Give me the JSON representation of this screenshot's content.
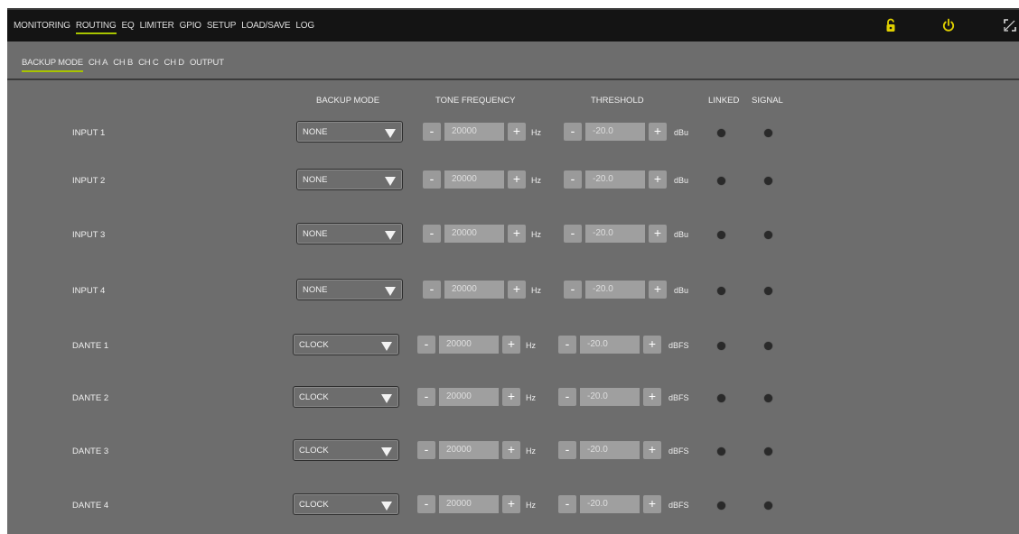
{
  "top_nav": [
    {
      "label": "MONITORING",
      "active": false
    },
    {
      "label": "ROUTING",
      "active": true
    },
    {
      "label": "EQ",
      "active": false
    },
    {
      "label": "LIMITER",
      "active": false
    },
    {
      "label": "GPIO",
      "active": false
    },
    {
      "label": "SETUP",
      "active": false
    },
    {
      "label": "LOAD/SAVE",
      "active": false
    },
    {
      "label": "LOG",
      "active": false
    }
  ],
  "top_icons": {
    "lock": "lock-icon",
    "power": "power-icon",
    "fullscreen": "fullscreen-icon"
  },
  "sub_nav": [
    {
      "label": "BACKUP MODE",
      "active": true
    },
    {
      "label": "CH A",
      "active": false
    },
    {
      "label": "CH B",
      "active": false
    },
    {
      "label": "CH C",
      "active": false
    },
    {
      "label": "CH D",
      "active": false
    },
    {
      "label": "OUTPUT",
      "active": false
    }
  ],
  "headers": {
    "backup_mode": "BACKUP MODE",
    "tone_frequency": "TONE FREQUENCY",
    "threshold": "THRESHOLD",
    "linked": "LINKED",
    "signal": "SIGNAL"
  },
  "rows": [
    {
      "label": "INPUT 1",
      "mode": "NONE",
      "minus": "-",
      "freq": "20000",
      "plus": "+",
      "freq_unit": "Hz",
      "thr": "-20.0",
      "thr_unit": "dBu"
    },
    {
      "label": "INPUT 2",
      "mode": "NONE",
      "minus": "-",
      "freq": "20000",
      "plus": "+",
      "freq_unit": "Hz",
      "thr": "-20.0",
      "thr_unit": "dBu"
    },
    {
      "label": "INPUT 3",
      "mode": "NONE",
      "minus": "-",
      "freq": "20000",
      "plus": "+",
      "freq_unit": "Hz",
      "thr": "-20.0",
      "thr_unit": "dBu"
    },
    {
      "label": "INPUT 4",
      "mode": "NONE",
      "minus": "-",
      "freq": "20000",
      "plus": "+",
      "freq_unit": "Hz",
      "thr": "-20.0",
      "thr_unit": "dBu"
    },
    {
      "label": "DANTE 1",
      "mode": "CLOCK",
      "minus": "-",
      "freq": "20000",
      "plus": "+",
      "freq_unit": "Hz",
      "thr": "-20.0",
      "thr_unit": "dBFS"
    },
    {
      "label": "DANTE 2",
      "mode": "CLOCK",
      "minus": "-",
      "freq": "20000",
      "plus": "+",
      "freq_unit": "Hz",
      "thr": "-20.0",
      "thr_unit": "dBFS"
    },
    {
      "label": "DANTE 3",
      "mode": "CLOCK",
      "minus": "-",
      "freq": "20000",
      "plus": "+",
      "freq_unit": "Hz",
      "thr": "-20.0",
      "thr_unit": "dBFS"
    },
    {
      "label": "DANTE 4",
      "mode": "CLOCK",
      "minus": "-",
      "freq": "20000",
      "plus": "+",
      "freq_unit": "Hz",
      "thr": "-20.0",
      "thr_unit": "dBFS"
    }
  ],
  "colors": {
    "accent": "#a8c400",
    "icon_yellow": "#e0d000",
    "led": "#2a2a2a",
    "background": "#6d6d6d",
    "topbar": "#141414"
  }
}
